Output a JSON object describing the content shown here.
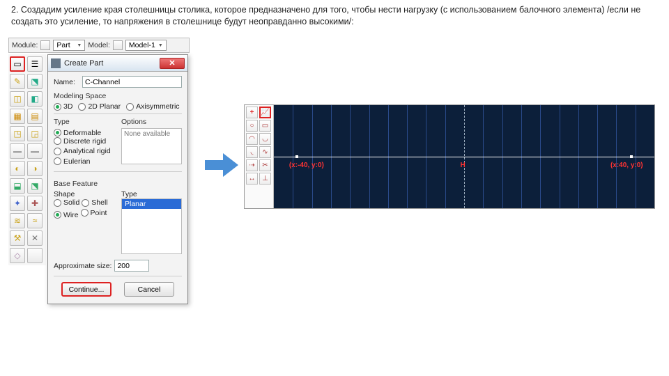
{
  "instruction": "2. Создадим усиление края столешницы столика, которое предназначено для того, чтобы нести нагрузку (с использованием балочного элемента) /если не создать это усиление, то напряжения в столешнице будут неоправданно высокими/:",
  "module_bar": {
    "module_label": "Module:",
    "module_value": "Part",
    "model_label": "Model:",
    "model_value": "Model-1"
  },
  "dialog": {
    "title": "Create Part",
    "name_label": "Name:",
    "name_value": "C-Channel",
    "modeling_space_label": "Modeling Space",
    "space": {
      "d3": "3D",
      "d2": "2D Planar",
      "axi": "Axisymmetric"
    },
    "type_label": "Type",
    "options_label": "Options",
    "options_none": "None available",
    "types": {
      "deformable": "Deformable",
      "discrete": "Discrete rigid",
      "analytical": "Analytical rigid",
      "eulerian": "Eulerian"
    },
    "base_feature_label": "Base Feature",
    "shape_label": "Shape",
    "type2_label": "Type",
    "shapes": {
      "solid": "Solid",
      "shell": "Shell",
      "wire": "Wire",
      "point": "Point"
    },
    "type2_value": "Planar",
    "approx_label": "Approximate size:",
    "approx_value": "200",
    "continue": "Continue...",
    "cancel": "Cancel"
  },
  "sketch": {
    "left_label": "(x:-40, y:0)",
    "right_label": "(x:40, y:0)",
    "h_label": "H"
  }
}
